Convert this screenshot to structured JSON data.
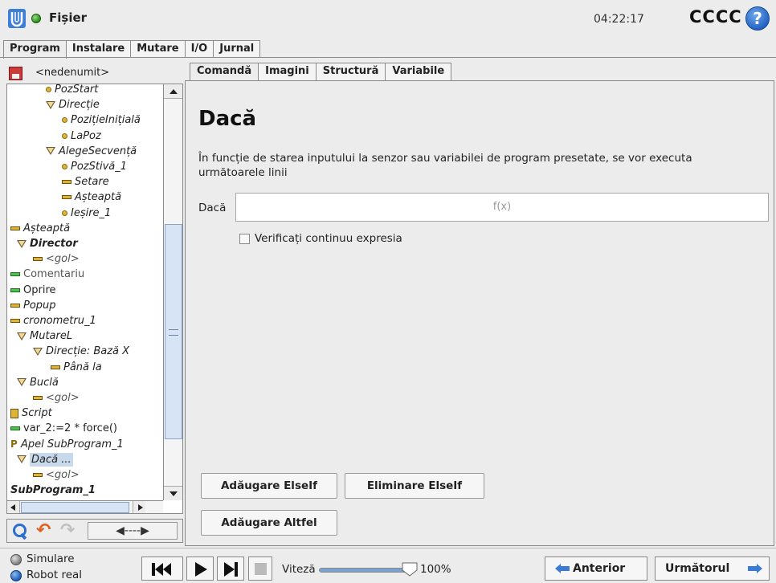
{
  "header": {
    "file_menu": "Fișier",
    "clock": "04:22:17",
    "robot_name": "CCCC",
    "help_label": "?"
  },
  "main_tabs": [
    {
      "label": "Program",
      "active": true
    },
    {
      "label": "Instalare",
      "active": false
    },
    {
      "label": "Mutare",
      "active": false
    },
    {
      "label": "I/O",
      "active": false
    },
    {
      "label": "Jurnal",
      "active": false
    }
  ],
  "tree": {
    "program_name": "<nedenumit>",
    "nodes": [
      {
        "label": "PozStart",
        "icon": "waypoint"
      },
      {
        "label": "Direcție",
        "icon": "folder"
      },
      {
        "label": "PozițieInițială",
        "icon": "waypoint"
      },
      {
        "label": "LaPoz",
        "icon": "waypoint"
      },
      {
        "label": "AlegeSecvență",
        "icon": "folder"
      },
      {
        "label": "PozStivă_1",
        "icon": "waypoint"
      },
      {
        "label": "Setare",
        "icon": "bar"
      },
      {
        "label": "Așteaptă",
        "icon": "bar"
      },
      {
        "label": "Ieșire_1",
        "icon": "waypoint"
      },
      {
        "label": "Așteaptă",
        "icon": "bar"
      },
      {
        "label": "Director",
        "icon": "folder"
      },
      {
        "label": "<gol>",
        "icon": "bar"
      },
      {
        "label": "Comentariu",
        "icon": "bar-green"
      },
      {
        "label": "Oprire",
        "icon": "bar-green"
      },
      {
        "label": "Popup",
        "icon": "bar"
      },
      {
        "label": "cronometru_1",
        "icon": "bar"
      },
      {
        "label": "MutareL",
        "icon": "folder"
      },
      {
        "label": "Direcție: Bază X",
        "icon": "folder"
      },
      {
        "label": "Până la",
        "icon": "bar"
      },
      {
        "label": "Buclă",
        "icon": "folder"
      },
      {
        "label": "<gol>",
        "icon": "bar"
      },
      {
        "label": "Script",
        "icon": "script"
      },
      {
        "label": "var_2:=2 * force()",
        "icon": "bar-green"
      },
      {
        "label": "Apel SubProgram_1",
        "icon": "call"
      },
      {
        "label": "Dacă ...",
        "icon": "folder"
      },
      {
        "label": "<gol>",
        "icon": "bar"
      },
      {
        "label": "SubProgram_1",
        "icon": "none"
      }
    ],
    "toolbar": {
      "move_label": "◀----▶"
    }
  },
  "sub_tabs": [
    {
      "label": "Comandă",
      "active": true
    },
    {
      "label": "Imagini",
      "active": false
    },
    {
      "label": "Structură",
      "active": false
    },
    {
      "label": "Variabile",
      "active": false
    }
  ],
  "command": {
    "title": "Dacă",
    "description": "În funcție de starea inputului la senzor sau variabilei de program presetate, se vor executa următoarele linii",
    "if_label": "Dacă",
    "expression_placeholder": "f(x)",
    "continuous_check_label": "Verificați continuu expresia",
    "continuous_checked": false,
    "add_elseif_label": "Adăugare ElseIf",
    "remove_elseif_label": "Eliminare ElseIf",
    "add_else_label": "Adăugare Altfel"
  },
  "footer": {
    "simulation_label": "Simulare",
    "real_robot_label": "Robot real",
    "speed_label": "Viteză",
    "speed_value": "100%",
    "speed_fraction": 1.0,
    "prev_label": "Anterior",
    "next_label": "Următorul"
  },
  "colors": {
    "accent_blue": "#2a6fd0",
    "status_green": "#2d8a1a",
    "waypoint_yellow": "#e0b43a",
    "selection": "#c9d9ec"
  }
}
